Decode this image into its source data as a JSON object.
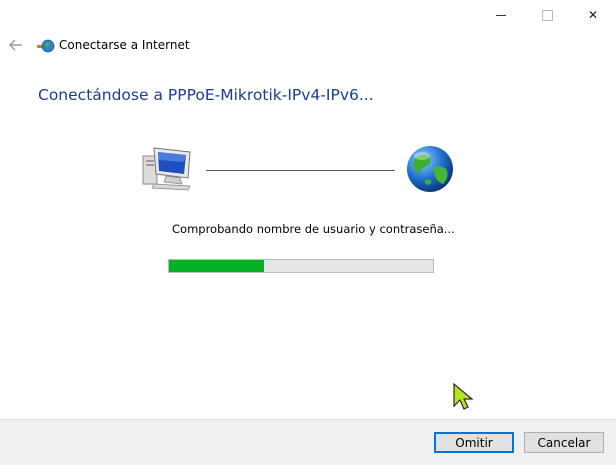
{
  "window": {
    "title": "Conectarse a Internet",
    "heading": "Conectándose a PPPoE-Mikrotik-IPv4-IPv6...",
    "controls": {
      "minimize": "—",
      "maximize": "",
      "close": "✕"
    }
  },
  "nav": {
    "back_icon": "back-arrow-icon"
  },
  "diagram": {
    "left_icon": "computer-icon",
    "right_icon": "globe-icon"
  },
  "status": {
    "text": "Comprobando nombre de usuario y contraseña...",
    "progress_fraction": 0.36,
    "progress_color": "#06b025"
  },
  "buttons": {
    "skip": "Omitir",
    "cancel": "Cancelar"
  },
  "colors": {
    "heading": "#1b3f8f",
    "footer_bg": "#f0f0f0",
    "default_button_border": "#0078d7"
  }
}
